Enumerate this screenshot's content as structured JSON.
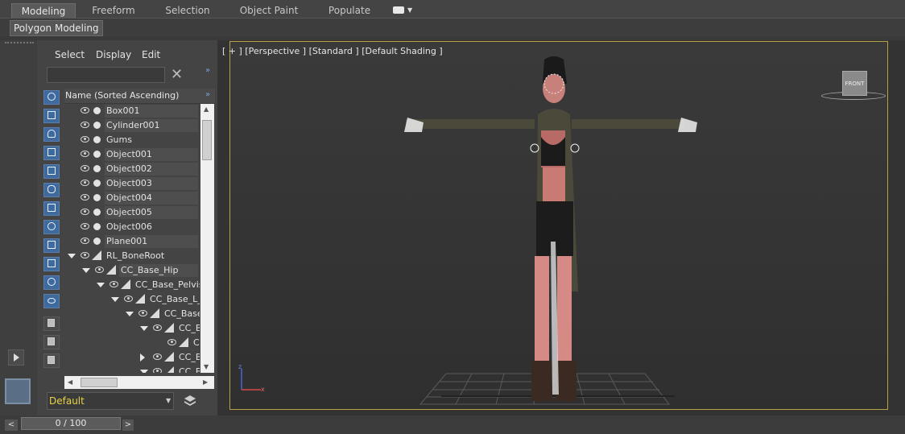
{
  "ribbon": {
    "tabs": [
      {
        "label": "Modeling",
        "active": true
      },
      {
        "label": "Freeform"
      },
      {
        "label": "Selection"
      },
      {
        "label": "Object Paint"
      },
      {
        "label": "Populate"
      }
    ],
    "panel_label": "Polygon Modeling"
  },
  "explorer": {
    "menu": [
      "Select",
      "Display",
      "Edit"
    ],
    "search": {
      "value": "",
      "placeholder": ""
    },
    "column_header": "Name (Sorted Ascending)",
    "items": [
      {
        "label": "Box001",
        "type": "object"
      },
      {
        "label": "Cylinder001",
        "type": "object"
      },
      {
        "label": "Gums",
        "type": "object"
      },
      {
        "label": "Object001",
        "type": "object"
      },
      {
        "label": "Object002",
        "type": "object"
      },
      {
        "label": "Object003",
        "type": "object"
      },
      {
        "label": "Object004",
        "type": "object"
      },
      {
        "label": "Object005",
        "type": "object"
      },
      {
        "label": "Object006",
        "type": "object"
      },
      {
        "label": "Plane001",
        "type": "object"
      },
      {
        "label": "RL_BoneRoot",
        "type": "bone"
      },
      {
        "label": "CC_Base_Hip",
        "type": "bone"
      },
      {
        "label": "CC_Base_Pelvis",
        "type": "bone"
      },
      {
        "label": "CC_Base_L_T",
        "type": "bone"
      },
      {
        "label": "CC_Base_",
        "type": "bone"
      },
      {
        "label": "CC_B",
        "type": "bone"
      },
      {
        "label": "C",
        "type": "bone"
      },
      {
        "label": "CC_B",
        "type": "bone"
      },
      {
        "label": "CC_B",
        "type": "bone"
      }
    ],
    "layer_value": "Default"
  },
  "viewport": {
    "label": "[ + ] [Perspective ] [Standard ] [Default Shading ]",
    "viewcube_label": "FRONT",
    "accent_color": "#b6a145"
  },
  "timeline": {
    "frame_label": "0 / 100",
    "prev_arrow": "<",
    "next_arrow": ">"
  }
}
